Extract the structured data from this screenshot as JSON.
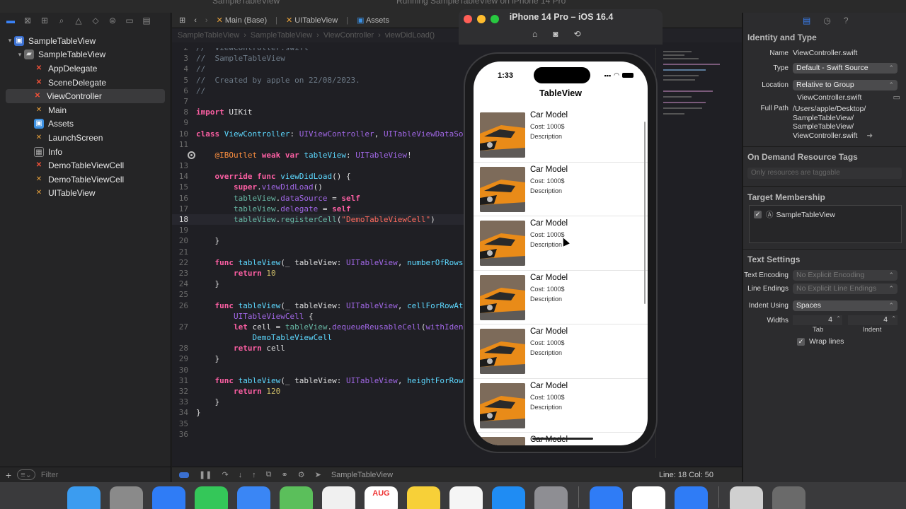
{
  "window": {
    "title_ghost": "SampleTableView",
    "running_ghost": "Running SampleTableView on iPhone 14 Pro"
  },
  "navigator": {
    "items": [
      {
        "label": "SampleTableView",
        "kind": "proj",
        "indent": 0,
        "disclosure": "▾"
      },
      {
        "label": "SampleTableView",
        "kind": "folder",
        "indent": 1,
        "disclosure": "▾"
      },
      {
        "label": "AppDelegate",
        "kind": "swift",
        "indent": 2
      },
      {
        "label": "SceneDelegate",
        "kind": "swift",
        "indent": 2
      },
      {
        "label": "ViewController",
        "kind": "swift",
        "indent": 2,
        "selected": true
      },
      {
        "label": "Main",
        "kind": "xib",
        "indent": 2
      },
      {
        "label": "Assets",
        "kind": "assets",
        "indent": 2
      },
      {
        "label": "LaunchScreen",
        "kind": "xib",
        "indent": 2
      },
      {
        "label": "Info",
        "kind": "plist",
        "indent": 2
      },
      {
        "label": "DemoTableViewCell",
        "kind": "swift",
        "indent": 2
      },
      {
        "label": "DemoTableViewCell",
        "kind": "xib",
        "indent": 2
      },
      {
        "label": "UITableView",
        "kind": "xib",
        "indent": 2
      }
    ],
    "filter_placeholder": "Filter"
  },
  "editor": {
    "tabs": [
      "Main (Base)",
      "UITableView",
      "Assets"
    ],
    "jumpbar": [
      "SampleTableView",
      "SampleTableView",
      "ViewController",
      "viewDidLoad()"
    ],
    "cursor_status": "Line: 18  Col: 50",
    "scheme": "SampleTableView"
  },
  "simulator": {
    "title": "iPhone 14 Pro – iOS 16.4",
    "time": "1:33",
    "nav_title": "TableView",
    "cell": {
      "title": "Car Model",
      "cost": "Cost: 1000$",
      "description": "Description"
    },
    "cell_count_visible": 7
  },
  "inspector": {
    "section_identity": "Identity and Type",
    "name_label": "Name",
    "name_value": "ViewController.swift",
    "type_label": "Type",
    "type_value": "Default - Swift Source",
    "location_label": "Location",
    "location_value": "Relative to Group",
    "location_file": "ViewController.swift",
    "fullpath_label": "Full Path",
    "fullpath_lines": [
      "/Users/apple/Desktop/",
      "SampleTableView/",
      "SampleTableView/",
      "ViewController.swift"
    ],
    "section_odr": "On Demand Resource Tags",
    "odr_placeholder": "Only resources are taggable",
    "section_target": "Target Membership",
    "target_name": "SampleTableView",
    "section_text": "Text Settings",
    "encoding_label": "Text Encoding",
    "encoding_value": "No Explicit Encoding",
    "endings_label": "Line Endings",
    "endings_value": "No Explicit Line Endings",
    "indent_label": "Indent Using",
    "indent_value": "Spaces",
    "widths_label": "Widths",
    "tab_value": "4",
    "indent_width_value": "4",
    "tab_caption": "Tab",
    "indent_caption": "Indent",
    "wrap_label": "Wrap lines"
  },
  "dock": {
    "calendar_month": "AUG"
  },
  "colors": {
    "accent": "#3a82f7",
    "keyword": "#fc5fa3",
    "type": "#5dd8ff",
    "string": "#fc6a5d",
    "number": "#d0bf69",
    "comment": "#6c7986"
  }
}
